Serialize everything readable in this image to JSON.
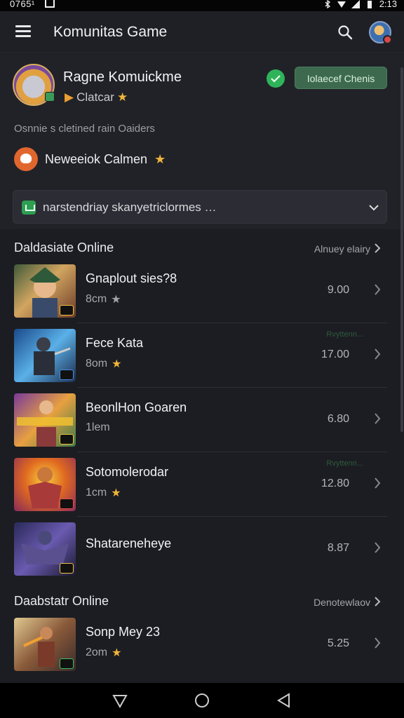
{
  "status_bar": {
    "time": "0765¹",
    "right_time": "2:13"
  },
  "app_bar": {
    "title": "Komunitas Game"
  },
  "profile": {
    "name": "Ragne Komuickme",
    "sub_label": "Clatcar",
    "action_button": "Iolaecef Chenis",
    "description": "Osnnie s cletined rain Oaiders"
  },
  "notification": {
    "label": "Neweeiok Calmen"
  },
  "dropdown": {
    "text": "narstendriay skanyetriclormes …"
  },
  "sections": [
    {
      "title": "Daldasiate Online",
      "link": "Alnuey elairy",
      "items": [
        {
          "name": "Gnaplout sies?8",
          "meta": "8cm",
          "star": "grey",
          "value": "9.00",
          "overlay": ""
        },
        {
          "name": "Fece Kata",
          "meta": "8om",
          "star": "gold",
          "value": "17.00",
          "overlay": "Rvyttenn..."
        },
        {
          "name": "BeonlHon Goaren",
          "meta": "1lem",
          "star": "",
          "value": "6.80",
          "overlay": ""
        },
        {
          "name": "Sotomolerodar",
          "meta": "1cm",
          "star": "gold",
          "value": "12.80",
          "overlay": "Rvyttenn..."
        },
        {
          "name": "Shatareneheye",
          "meta": "",
          "star": "",
          "value": "8.87",
          "overlay": ""
        }
      ]
    },
    {
      "title": "Daabstatr Online",
      "link": "Denotewlaov",
      "items": [
        {
          "name": "Sonp Mey 23",
          "meta": "2om",
          "star": "gold",
          "value": "5.25",
          "overlay": ""
        }
      ]
    }
  ],
  "colors": {
    "background": "#1c1d22",
    "accent_green": "#3d6a4e",
    "star": "#f0b43c",
    "notif_orange": "#e0662e"
  },
  "icons": {
    "menu": "hamburger-icon",
    "search": "search-icon",
    "chevron": "chevron-right-icon",
    "dropdown": "chevron-down-icon",
    "nav_back": "back-triangle-icon",
    "nav_home": "home-circle-icon",
    "nav_recent": "recent-triangle-icon"
  }
}
